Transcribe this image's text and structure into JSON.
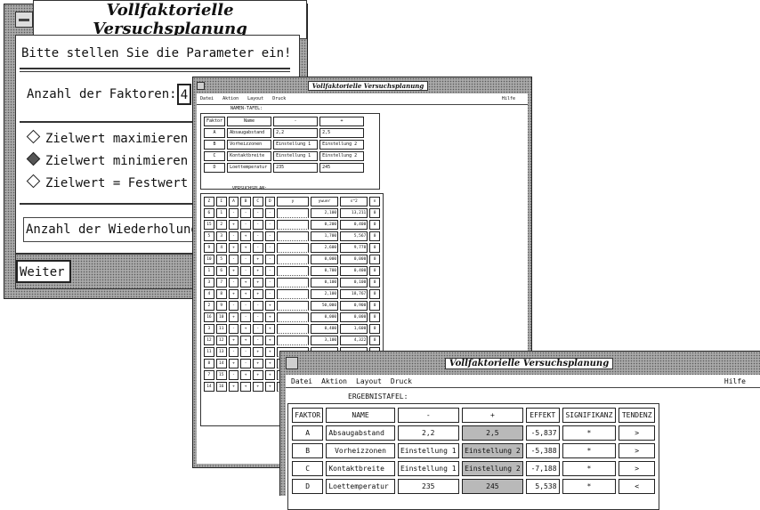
{
  "title": "Vollfaktorielle Versuchsplanung",
  "win1": {
    "prompt": "Bitte stellen Sie die Parameter ein!",
    "factors_label": "Anzahl der Faktoren:",
    "factors_value": "4",
    "options": [
      {
        "label": "Zielwert maximieren",
        "selected": false
      },
      {
        "label": "Zielwert minimieren",
        "selected": true
      },
      {
        "label": "Zielwert = Festwert",
        "selected": false
      }
    ],
    "repeats_label": "Anzahl der Wiederholung",
    "next_button": "Weiter"
  },
  "menu": {
    "items": [
      "Datei",
      "Aktion",
      "Layout",
      "Druck"
    ],
    "help": "Hilfe"
  },
  "win2": {
    "names_title": "NAMEN-TAFEL:",
    "names_headers": [
      "Faktor",
      "Name",
      "-",
      "+"
    ],
    "names_rows": [
      [
        "A",
        "Absaugabstand",
        "2,2",
        "2,5"
      ],
      [
        "B",
        "Vorheizzonen",
        "Einstellung 1",
        "Einstellung 2"
      ],
      [
        "C",
        "Kontaktbreite",
        "Einstellung 1",
        "Einstellung 2"
      ],
      [
        "D",
        "Loettemperatur",
        "235",
        "245"
      ]
    ],
    "plan_title": "VERSUCHSPLAN:",
    "plan_headers": [
      "Z",
      "I",
      "A",
      "B",
      "C",
      "D",
      "y",
      "ywuer",
      "s^2",
      "n"
    ],
    "plan_rows": [
      [
        "6",
        "1",
        "-",
        "-",
        "-",
        "-",
        "",
        "2,100",
        "13,211",
        "0"
      ],
      [
        "15",
        "2",
        "+",
        "-",
        "-",
        "-",
        "",
        "0,200",
        "0,400",
        "0"
      ],
      [
        "5",
        "3",
        "-",
        "+",
        "-",
        "-",
        "",
        "1,700",
        "5,567",
        "0"
      ],
      [
        "9",
        "4",
        "+",
        "+",
        "-",
        "-",
        "",
        "2,600",
        "9,778",
        "0"
      ],
      [
        "10",
        "5",
        "-",
        "-",
        "+",
        "-",
        "",
        "0,000",
        "0,000",
        "0"
      ],
      [
        "1",
        "6",
        "+",
        "-",
        "+",
        "-",
        "",
        "0,700",
        "0,400",
        "0"
      ],
      [
        "3",
        "7",
        "-",
        "+",
        "+",
        "-",
        "",
        "0,100",
        "0,100",
        "0"
      ],
      [
        "4",
        "8",
        "+",
        "+",
        "+",
        "-",
        "",
        "2,100",
        "18,767",
        "0"
      ],
      [
        "2",
        "9",
        "-",
        "-",
        "-",
        "+",
        "",
        "50,000",
        "0,900",
        "0"
      ],
      [
        "16",
        "10",
        "+",
        "-",
        "-",
        "+",
        "",
        "0,000",
        "0,000",
        "0"
      ],
      [
        "3",
        "11",
        "-",
        "+",
        "-",
        "+",
        "",
        "0,400",
        "1,600",
        "0"
      ],
      [
        "12",
        "12",
        "+",
        "+",
        "-",
        "+",
        "",
        "3,100",
        "4,322",
        "0"
      ],
      [
        "11",
        "13",
        "-",
        "-",
        "+",
        "+",
        "",
        "",
        "",
        ""
      ],
      [
        "8",
        "14",
        "+",
        "-",
        "+",
        "+",
        "",
        "",
        "",
        ""
      ],
      [
        "7",
        "15",
        "-",
        "+",
        "+",
        "+",
        "",
        "",
        "",
        ""
      ],
      [
        "14",
        "16",
        "+",
        "+",
        "+",
        "+",
        "",
        "",
        "",
        ""
      ]
    ]
  },
  "win3": {
    "results_title": "ERGEBNISTAFEL:",
    "headers": [
      "FAKTOR",
      "NAME",
      "-",
      "+",
      "EFFEKT",
      "SIGNIFIKANZ",
      "TENDENZ"
    ],
    "rows": [
      [
        "A",
        "Absaugabstand",
        "2,2",
        "2,5",
        "-5,837",
        "*",
        ">"
      ],
      [
        "B",
        "Vorheizzonen",
        "Einstellung 1",
        "Einstellung 2",
        "-5,388",
        "*",
        ">"
      ],
      [
        "C",
        "Kontaktbreite",
        "Einstellung 1",
        "Einstellung 2",
        "-7,188",
        "*",
        ">"
      ],
      [
        "D",
        "Loettemperatur",
        "235",
        "245",
        "5,538",
        "*",
        "<"
      ]
    ]
  }
}
